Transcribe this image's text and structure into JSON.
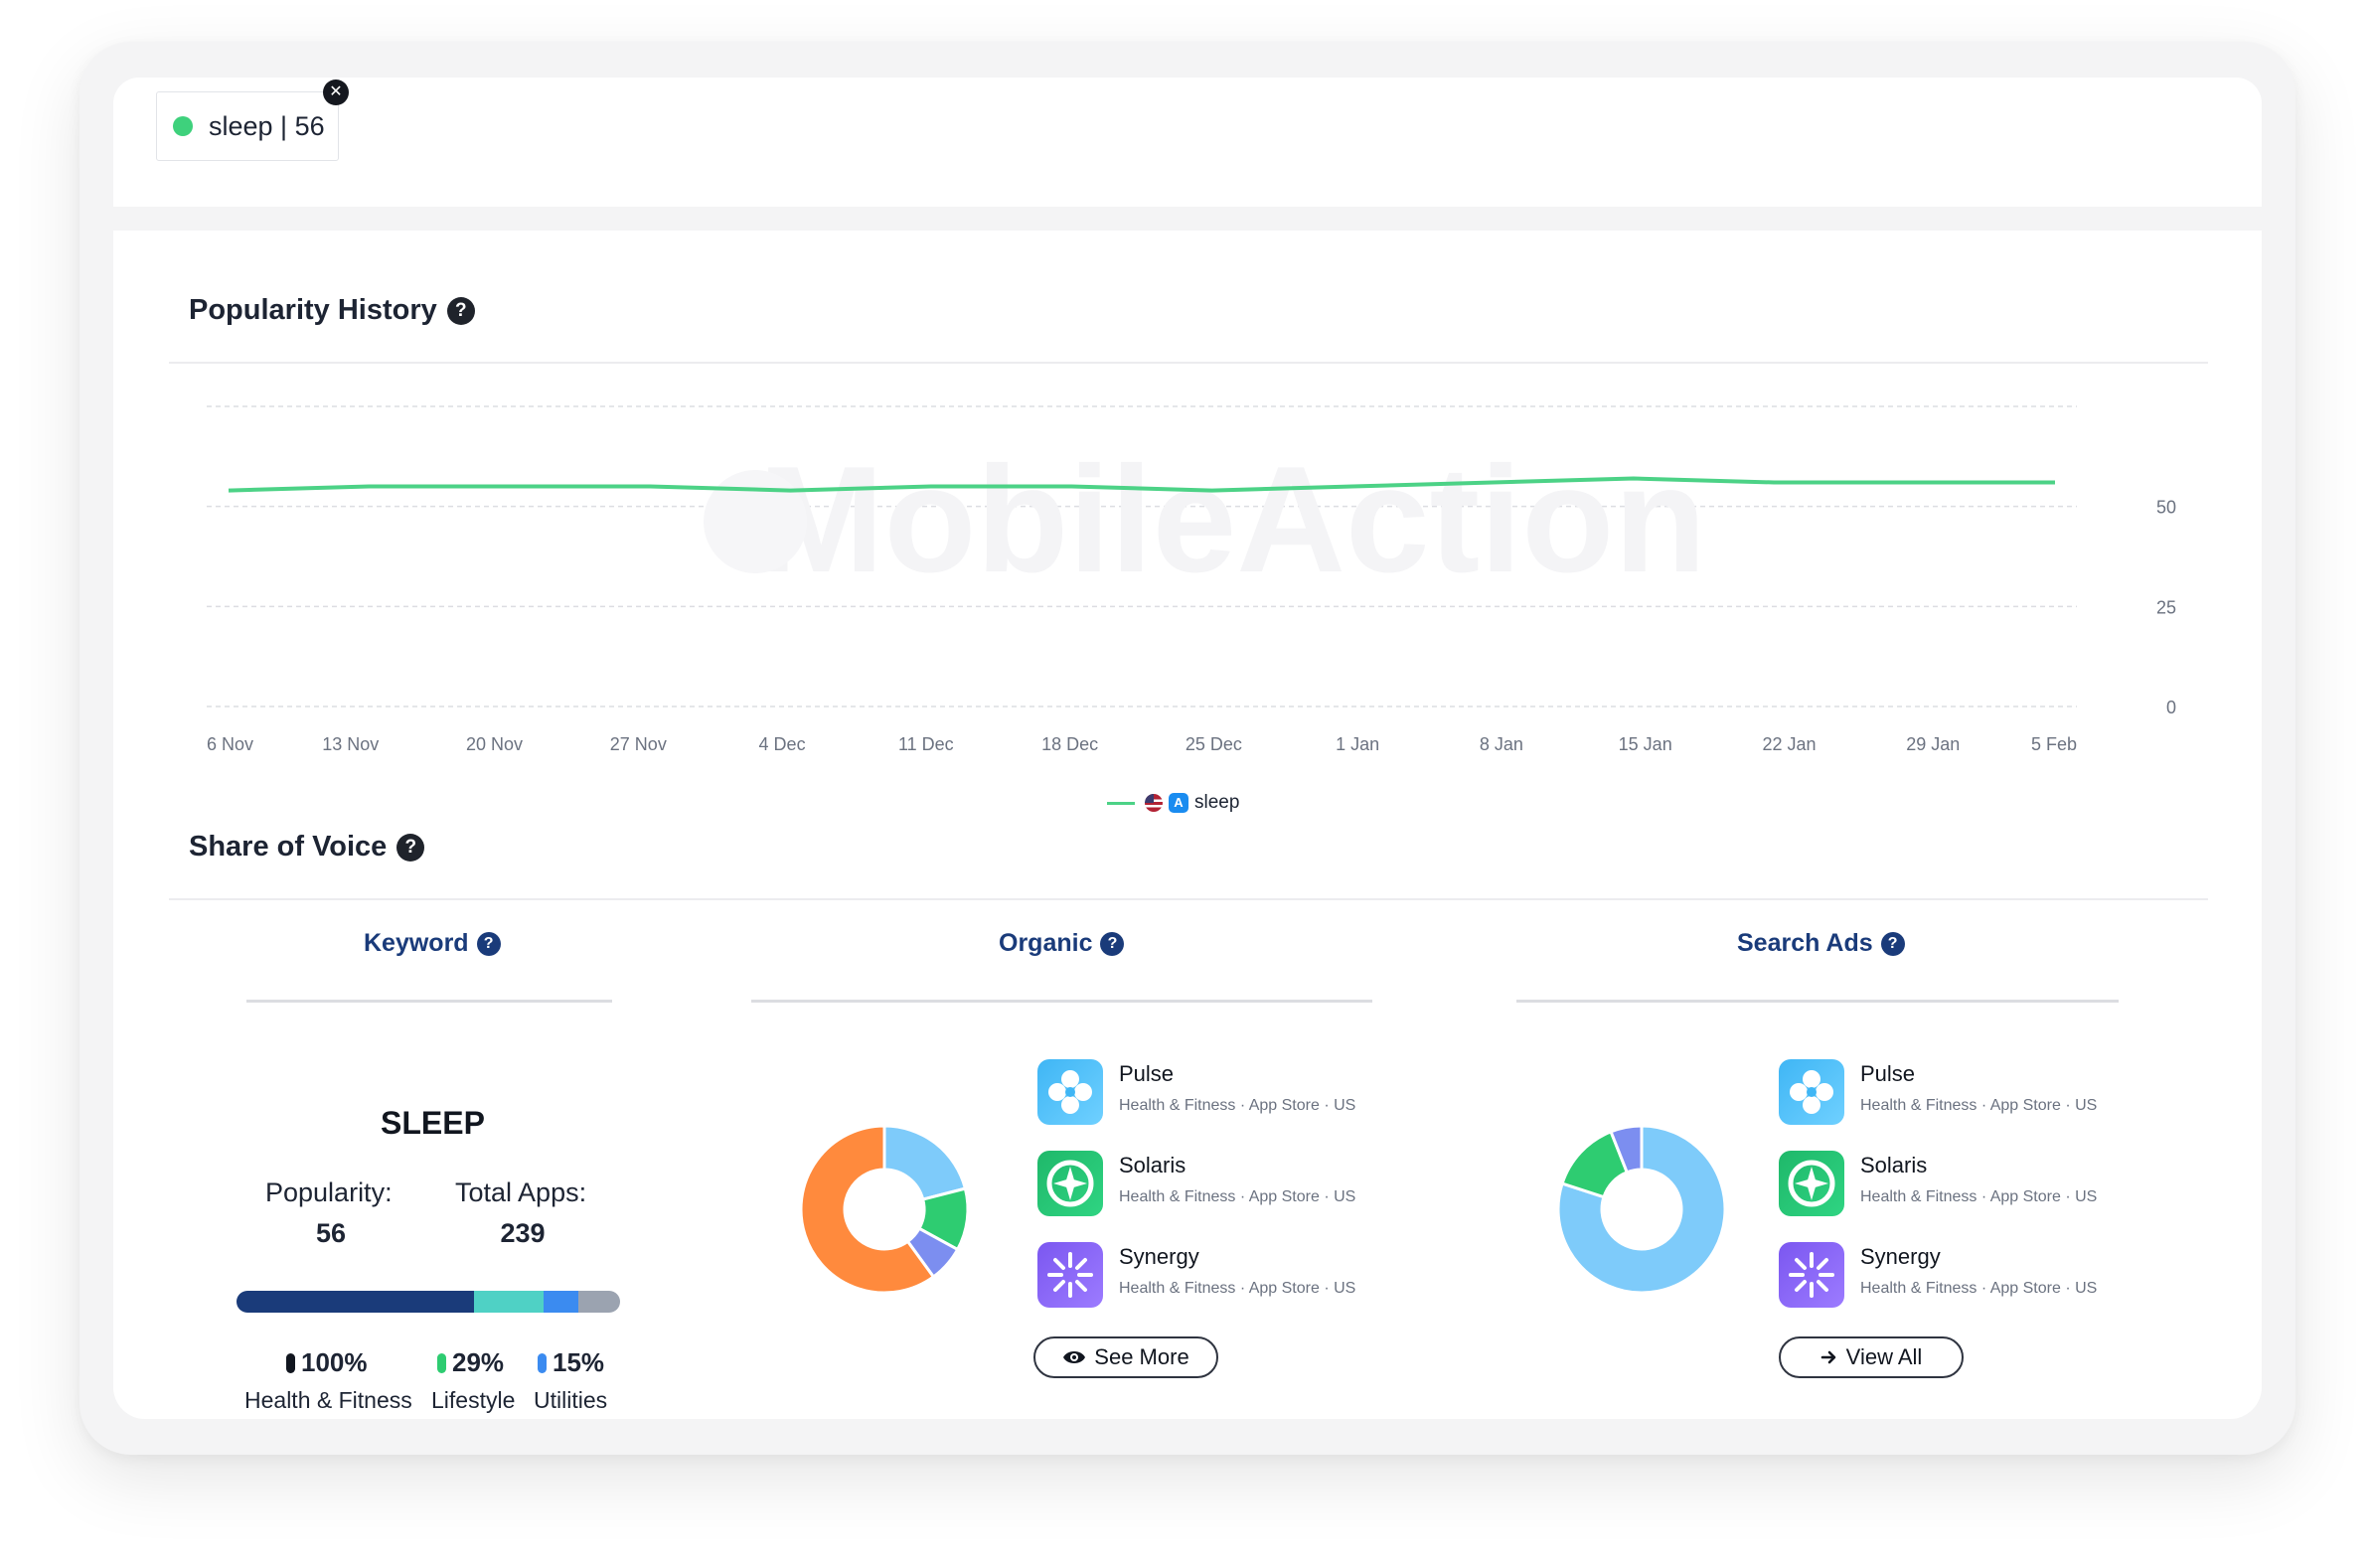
{
  "keyword_chip": {
    "label": "sleep | 56",
    "dot_color": "#3ed17c",
    "close_icon": "close-icon"
  },
  "popularity_history": {
    "title": "Popularity History",
    "help": "?",
    "legend": {
      "label": "sleep",
      "country": "US",
      "store": "App Store"
    }
  },
  "chart_data": {
    "type": "line",
    "x": [
      "6 Nov",
      "13 Nov",
      "20 Nov",
      "27 Nov",
      "4 Dec",
      "11 Dec",
      "18 Dec",
      "25 Dec",
      "1 Jan",
      "8 Jan",
      "15 Jan",
      "22 Jan",
      "29 Jan",
      "5 Feb"
    ],
    "series": [
      {
        "name": "sleep",
        "color": "#4cd286",
        "values": [
          54,
          55,
          55,
          55,
          54,
          55,
          55,
          54,
          55,
          56,
          57,
          56,
          56,
          56
        ]
      }
    ],
    "y_ticks": [
      "0",
      "25",
      "50"
    ],
    "ylim": [
      0,
      75
    ],
    "y_axis_side": "right",
    "grid": true,
    "legend_position": "bottom-center"
  },
  "share_of_voice": {
    "title": "Share of Voice",
    "help": "?",
    "tabs": {
      "keyword": "Keyword",
      "organic": "Organic",
      "search_ads": "Search Ads"
    },
    "keyword_panel": {
      "keyword": "SLEEP",
      "popularity_label": "Popularity:",
      "popularity_value": "56",
      "total_apps_label": "Total Apps:",
      "total_apps_value": "239",
      "categories": [
        {
          "pct": "100%",
          "name": "Health & Fitness",
          "color": "#1a3b7a",
          "bar_share": 0.62
        },
        {
          "pct": "29%",
          "name": "Lifestyle",
          "color": "#4fd1c5",
          "bar_share": 0.18
        },
        {
          "pct": "15%",
          "name": "Utilities",
          "color": "#3b8bf0",
          "bar_share": 0.09
        }
      ],
      "bar_remainder_color": "#9ba3b0"
    },
    "organic": {
      "donut": [
        {
          "value": 21,
          "color": "#7ecbfa"
        },
        {
          "value": 12,
          "color": "#2ecc71"
        },
        {
          "value": 7,
          "color": "#7c8ef0"
        },
        {
          "value": 60,
          "color": "#ff8a3d"
        }
      ],
      "apps": [
        {
          "name": "Pulse",
          "meta": "Health & Fitness · App Store · US",
          "icon": "pulse-app-icon"
        },
        {
          "name": "Solaris",
          "meta": "Health & Fitness · App Store · US",
          "icon": "solaris-app-icon"
        },
        {
          "name": "Synergy",
          "meta": "Health & Fitness · App Store · US",
          "icon": "synergy-app-icon"
        }
      ],
      "button": "See More",
      "button_icon": "eye-icon"
    },
    "search_ads": {
      "donut": [
        {
          "value": 80,
          "color": "#7ecbfa"
        },
        {
          "value": 14,
          "color": "#2ecc71"
        },
        {
          "value": 6,
          "color": "#7c8ef0"
        }
      ],
      "apps": [
        {
          "name": "Pulse",
          "meta": "Health & Fitness · App Store · US",
          "icon": "pulse-app-icon"
        },
        {
          "name": "Solaris",
          "meta": "Health & Fitness · App Store · US",
          "icon": "solaris-app-icon"
        },
        {
          "name": "Synergy",
          "meta": "Health & Fitness · App Store · US",
          "icon": "synergy-app-icon"
        }
      ],
      "button": "View All",
      "button_icon": "arrow-right-icon"
    }
  }
}
